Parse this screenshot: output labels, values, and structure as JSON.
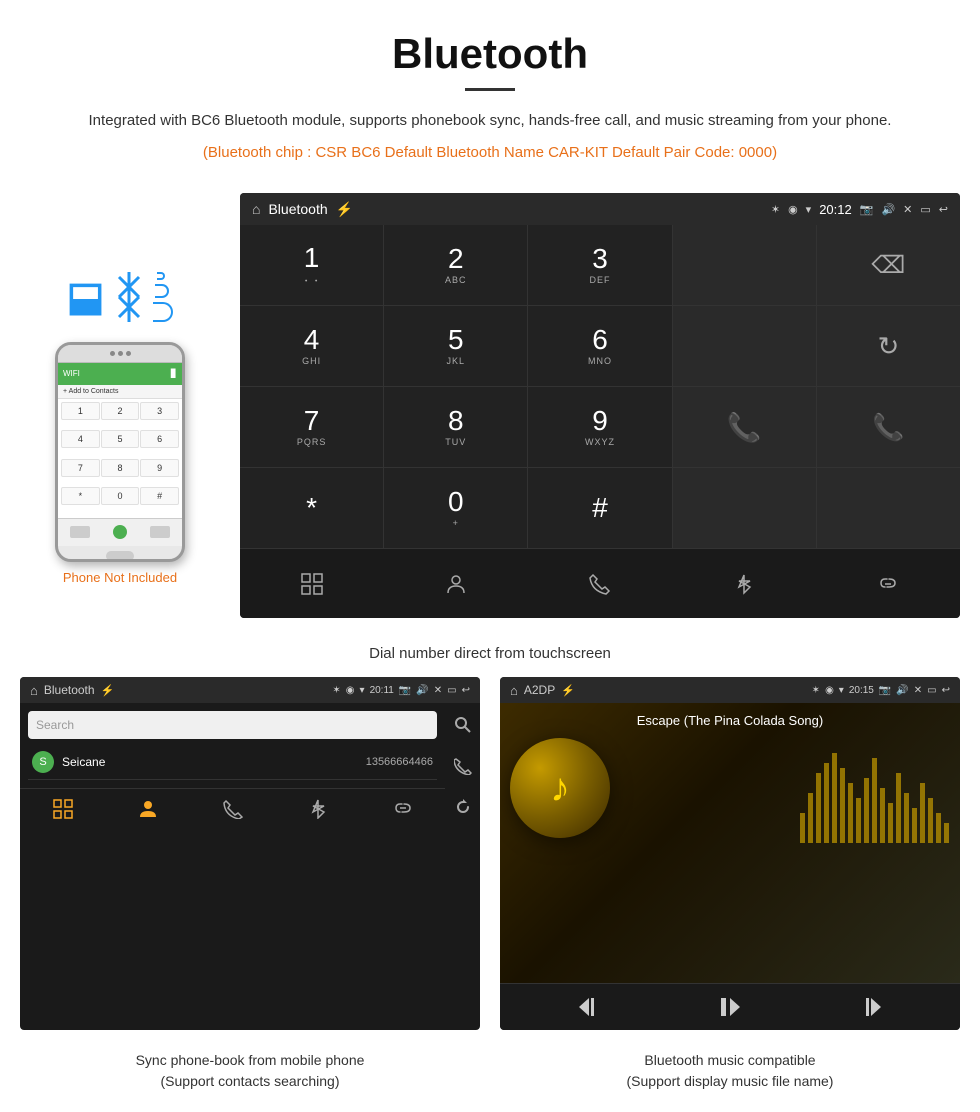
{
  "header": {
    "title": "Bluetooth",
    "description": "Integrated with BC6 Bluetooth module, supports phonebook sync, hands-free call, and music streaming from your phone.",
    "specs": "(Bluetooth chip : CSR BC6    Default Bluetooth Name CAR-KIT    Default Pair Code: 0000)"
  },
  "phone_note": "Phone Not Included",
  "dial_screen": {
    "status_bar": {
      "label": "Bluetooth",
      "time": "20:12",
      "icons": [
        "home",
        "usb",
        "bluetooth",
        "location",
        "wifi",
        "time",
        "camera",
        "volume",
        "x",
        "screen",
        "back"
      ]
    },
    "keys": [
      {
        "num": "1",
        "sub": ""
      },
      {
        "num": "2",
        "sub": "ABC"
      },
      {
        "num": "3",
        "sub": "DEF"
      },
      {
        "num": "4",
        "sub": "GHI"
      },
      {
        "num": "5",
        "sub": "JKL"
      },
      {
        "num": "6",
        "sub": "MNO"
      },
      {
        "num": "7",
        "sub": "PQRS"
      },
      {
        "num": "8",
        "sub": "TUV"
      },
      {
        "num": "9",
        "sub": "WXYZ"
      },
      {
        "num": "*",
        "sub": ""
      },
      {
        "num": "0",
        "sub": "+"
      },
      {
        "num": "#",
        "sub": ""
      }
    ],
    "nav_icons": [
      "grid",
      "person",
      "phone",
      "bluetooth",
      "link"
    ]
  },
  "caption": "Dial number direct from touchscreen",
  "phonebook_screen": {
    "status_bar": {
      "label": "Bluetooth",
      "time": "20:11"
    },
    "search_placeholder": "Search",
    "contacts": [
      {
        "initial": "S",
        "name": "Seicane",
        "number": "13566664466"
      }
    ],
    "right_icons": [
      "search",
      "phone",
      "refresh"
    ],
    "nav_icons": [
      "grid",
      "person",
      "phone",
      "bluetooth",
      "link"
    ]
  },
  "music_screen": {
    "status_bar": {
      "label": "A2DP",
      "time": "20:15"
    },
    "song_title": "Escape (The Pina Colada Song)",
    "controls": [
      "prev",
      "play-pause",
      "next"
    ]
  },
  "bottom_captions": {
    "left": "Sync phone-book from mobile phone\n(Support contacts searching)",
    "right": "Bluetooth music compatible\n(Support display music file name)"
  }
}
